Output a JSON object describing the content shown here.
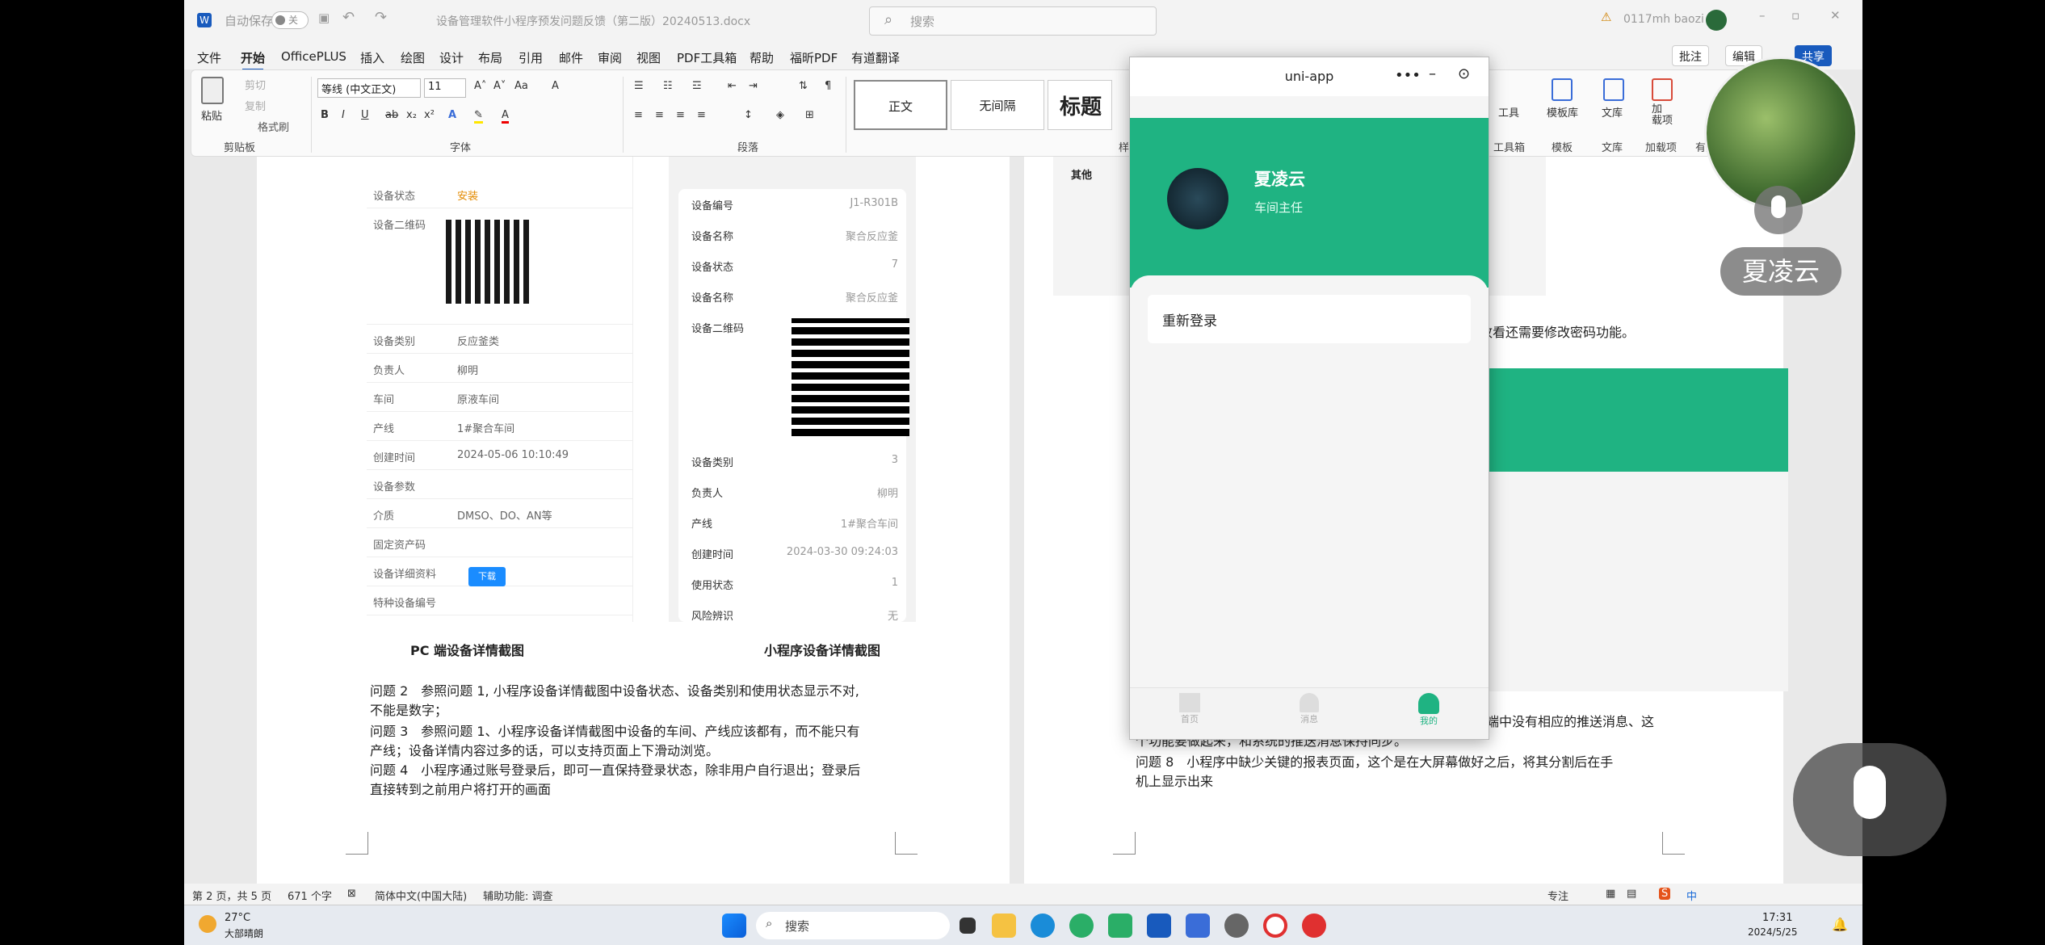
{
  "titlebar": {
    "autosave": "自动保存",
    "autosave_state": "关",
    "filename": "设备管理软件小程序预发问题反馈（第二版）20240513.docx",
    "search": "搜索",
    "user": "0117mh baozi"
  },
  "menu": [
    "文件",
    "开始",
    "OfficePLUS",
    "插入",
    "绘图",
    "设计",
    "布局",
    "引用",
    "邮件",
    "审阅",
    "视图",
    "PDF工具箱",
    "帮助",
    "福昕PDF",
    "有道翻译"
  ],
  "topbuttons": {
    "comment": "批注",
    "edit": "编辑",
    "share": "共享"
  },
  "ribbon": {
    "paste": "粘贴",
    "cut": "剪切",
    "copy": "复制",
    "format_painter": "格式刷",
    "clipboard": "剪贴板",
    "font_name": "等线 (中文正文)",
    "font_size": "11",
    "font": "字体",
    "paragraph": "段落",
    "style_normal": "正文",
    "style_nospacing": "无间隔",
    "style_heading": "标题",
    "style_group": "样",
    "tools": "工具",
    "toolbox": "工具箱",
    "template": "模板库",
    "template_group": "模板",
    "library": "文库",
    "library_group": "文库",
    "addin": "加载项",
    "addin_label": "加\n载项",
    "youdao": "有道"
  },
  "left_pc": {
    "rows": [
      [
        "设备状态",
        "安装"
      ],
      [
        "设备二维码",
        ""
      ],
      [
        "设备类别",
        "反应釜类"
      ],
      [
        "负责人",
        "柳明"
      ],
      [
        "车间",
        "原液车间"
      ],
      [
        "产线",
        "1#聚合车间"
      ],
      [
        "创建时间",
        "2024-05-06 10:10:49"
      ],
      [
        "设备参数",
        ""
      ],
      [
        "介质",
        "DMSO、DO、AN等"
      ],
      [
        "固定资产码",
        ""
      ],
      [
        "设备详细资料",
        ""
      ],
      [
        "特种设备编号",
        ""
      ]
    ],
    "download": "下载"
  },
  "left_mp": {
    "rows": [
      [
        "设备编号",
        "J1-R301B"
      ],
      [
        "设备名称",
        "聚合反应釜"
      ],
      [
        "设备状态",
        "7"
      ],
      [
        "设备名称",
        "聚合反应釜"
      ],
      [
        "设备二维码",
        ""
      ],
      [
        "设备类别",
        "3"
      ],
      [
        "负责人",
        "柳明"
      ],
      [
        "产线",
        "1#聚合车间"
      ],
      [
        "创建时间",
        "2024-03-30 09:24:03"
      ],
      [
        "使用状态",
        "1"
      ],
      [
        "风险辨识",
        "无"
      ]
    ]
  },
  "captions": {
    "pc": "PC 端设备详情截图",
    "mp": "小程序设备详情截图"
  },
  "issues": [
    "问题 2　参照问题 1, 小程序设备详情截图中设备状态、设备类别和使用状态显示不对,",
    "不能是数字；",
    "问题 3　参照问题 1、小程序设备详情截图中设备的车间、产线应该都有，而不能只有",
    "产线；设备详情内容过多的话，可以支持页面上下滑动浏览。",
    "问题 4　小程序通过账号登录后，即可一直保持登录状态，除非用户自行退出；登录后",
    "直接转到之前用户将打开的画面"
  ],
  "right_page": {
    "other": "其他",
    "line_a": "改看还需要修改密码功能。",
    "line_b": "端中没有相应的推送消息、这",
    "line_c": "个功能要做起来，和系统的推送消息保持同步。",
    "line_d": "问题 8　小程序中缺少关键的报表页面，这个是在大屏幕做好之后，将其分割后在手",
    "line_e": "机上显示出来"
  },
  "uniapp": {
    "title": "uni-app",
    "name": "夏凌云",
    "role": "车间主任",
    "relogin": "重新登录",
    "tabs": [
      "首页",
      "消息",
      "我的"
    ]
  },
  "statusbar": {
    "page": "第 2 页，共 5 页",
    "words": "671 个字",
    "lang": "简体中文(中国大陆)",
    "access": "辅助功能: 调查",
    "focus": "专注"
  },
  "taskbar": {
    "weather_temp": "27°C",
    "weather_desc": "大部晴朗",
    "search": "搜索",
    "time": "17:31",
    "date": "2024/5/25"
  },
  "camera": {
    "name": "夏凌云"
  }
}
